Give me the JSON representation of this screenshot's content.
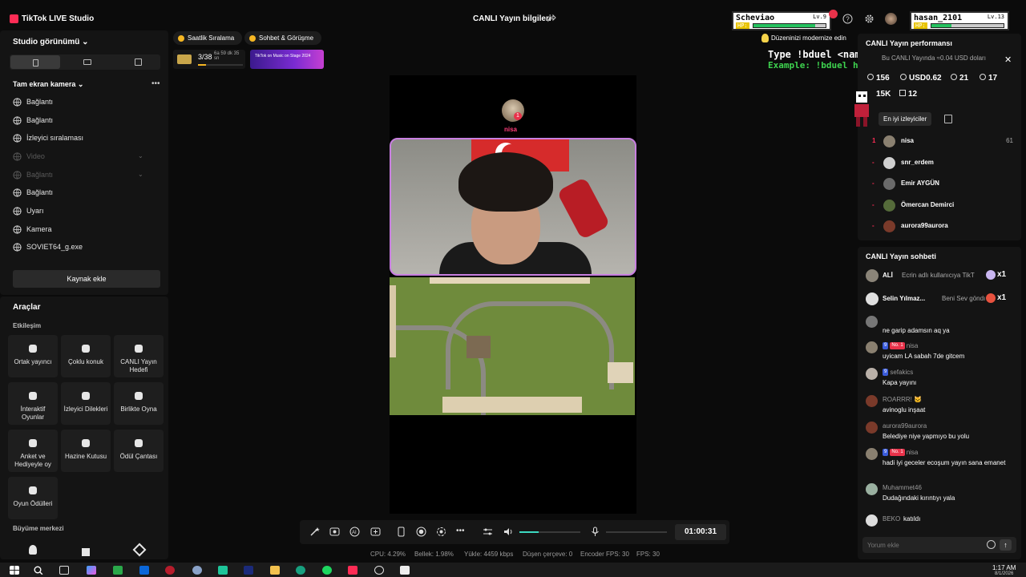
{
  "app": {
    "title": "TikTok LIVE Studio",
    "live_info": "CANLI Yayın bilgileri"
  },
  "hud": {
    "left": {
      "name": "Scheviao",
      "level": "Lv.9",
      "hp_label": "HP:",
      "hp": 0.85
    },
    "right": {
      "name": "hasan_2101",
      "level": "Lv.13",
      "hp_label": "HP:",
      "hp": 0.28
    }
  },
  "sidebar": {
    "title": "Studio görünümü",
    "camera_header": "Tam ekran kamera",
    "sources": [
      {
        "label": "Bağlantı",
        "icon": "globe-icon",
        "dim": false
      },
      {
        "label": "Bağlantı",
        "icon": "globe-icon",
        "dim": false
      },
      {
        "label": "İzleyici sıralaması",
        "icon": "globe-icon",
        "dim": false
      },
      {
        "label": "Video",
        "icon": "globe-icon",
        "dim": true
      },
      {
        "label": "Bağlantı",
        "icon": "globe-icon",
        "dim": true
      },
      {
        "label": "Bağlantı",
        "icon": "globe-icon",
        "dim": false
      },
      {
        "label": "Uyarı",
        "icon": "bell-icon",
        "dim": false
      },
      {
        "label": "Kamera",
        "icon": "camera-icon",
        "dim": false
      },
      {
        "label": "SOVIET64_g.exe",
        "icon": "window-icon",
        "dim": false
      }
    ],
    "add_source": "Kaynak ekle"
  },
  "tools": {
    "title": "Araçlar",
    "section": "Etkileşim",
    "items": [
      {
        "label": "Ortak yayıncı",
        "icon": "link-icon"
      },
      {
        "label": "Çoklu konuk",
        "icon": "users-icon"
      },
      {
        "label": "CANLI Yayın Hedefi",
        "icon": "target-icon"
      },
      {
        "label": "İnteraktif Oyunlar",
        "icon": "gamepad-icon"
      },
      {
        "label": "İzleyici Dilekleri",
        "icon": "gift-icon"
      },
      {
        "label": "Birlikte Oyna",
        "icon": "joystick-icon"
      },
      {
        "label": "Anket ve Hediyeyle oy",
        "icon": "poll-icon"
      },
      {
        "label": "Hazine Kutusu",
        "icon": "chest-icon"
      },
      {
        "label": "Ödül Çantası",
        "icon": "bag-icon"
      },
      {
        "label": "Oyun Ödülleri",
        "icon": "trophy-icon"
      }
    ],
    "section2": "Büyüme merkezi"
  },
  "stage": {
    "pills": [
      "Saatlik Sıralama",
      "Sohbet & Görüşme"
    ],
    "rank": "3/38",
    "rank_time": "6a 59 dk 35 sn",
    "banner_text": "TikTok on Music on Stage 2024",
    "avatar_name": "nisa",
    "avatar_badge": "1",
    "chat_cmd_1": "Type !bduel <name> to play",
    "chat_cmd_2": "Example: !bduel hasan_2101"
  },
  "perf": {
    "title": "CANLI Yayın performansı",
    "tip": "Düzeninizi modernize edin",
    "earnings_note": "Bu CANLI Yayında ≈0.04 USD doları",
    "stats": [
      {
        "icon": "diamond-icon",
        "value": "156"
      },
      {
        "icon": "coin-icon",
        "value": "USD0.62"
      },
      {
        "icon": "people-icon",
        "value": "21"
      },
      {
        "icon": "follow-icon",
        "value": "17"
      }
    ],
    "stats2": [
      {
        "icon": "heart-icon",
        "value": "15K"
      },
      {
        "icon": "gift-box-icon",
        "value": "12"
      }
    ],
    "top_viewers_label": "En iyi izleyiciler",
    "viewers": [
      {
        "rank": "1",
        "name": "nisa",
        "score": "61"
      },
      {
        "rank": "-",
        "name": "snr_erdem",
        "score": ""
      },
      {
        "rank": "-",
        "name": "Emir AYGÜN",
        "score": ""
      },
      {
        "rank": "-",
        "name": "Ömercan Demirci",
        "score": ""
      },
      {
        "rank": "-",
        "name": "aurora99aurora",
        "score": ""
      }
    ]
  },
  "chat": {
    "title": "CANLI Yayın sohbeti",
    "gifts": [
      {
        "name": "ALİ",
        "message": "Ecrin adlı kullanıcıya TikT",
        "count": "x1"
      },
      {
        "name": "Selin Yılmaz...",
        "message": "Beni Sev göndı",
        "count": "x1"
      }
    ],
    "messages": [
      {
        "user": "",
        "text": "ne garip adamsın aq ya",
        "badges": []
      },
      {
        "user": "nisa",
        "text": "uyicam LA sabah 7de gitcem",
        "badges": [
          "9",
          "No. 1"
        ]
      },
      {
        "user": "sefakics",
        "text": "Kapa yayını",
        "badges": [
          "9"
        ]
      },
      {
        "user": "ROARRR! 🐱",
        "text": "avinoglu inşaat",
        "badges": []
      },
      {
        "user": "aurora99aurora",
        "text": "Belediye niye yapmıyo bu yolu",
        "badges": []
      },
      {
        "user": "nisa",
        "text": "hadi iyi geceler ecoşum yayın sana emanet",
        "badges": [
          "9",
          "No. 1"
        ]
      },
      {
        "user": "Muhammet46",
        "text": "Dudağındaki kırıntıyı yala",
        "badges": []
      },
      {
        "user": "BEKO",
        "text": "katıldı",
        "badges": []
      }
    ],
    "placeholder": "Yorum ekle"
  },
  "controls": {
    "timer": "01:00:31",
    "volume": 0.32,
    "mic": 0
  },
  "status": {
    "cpu": "CPU: 4.29%",
    "memory": "Bellek: 1.98%",
    "upload": "Yükle: 4459 kbps",
    "dropped": "Düşen çerçeve: 0",
    "encoder": "Encoder FPS: 30",
    "fps": "FPS: 30"
  },
  "taskbar": {
    "time": "1:17 AM",
    "date": "8/1/2026"
  },
  "colors": {
    "accent": "#fe2c55",
    "teal": "#3cd9c1",
    "hp_green": "#26c260",
    "panel": "#141414",
    "bg": "#0b0b0b"
  }
}
